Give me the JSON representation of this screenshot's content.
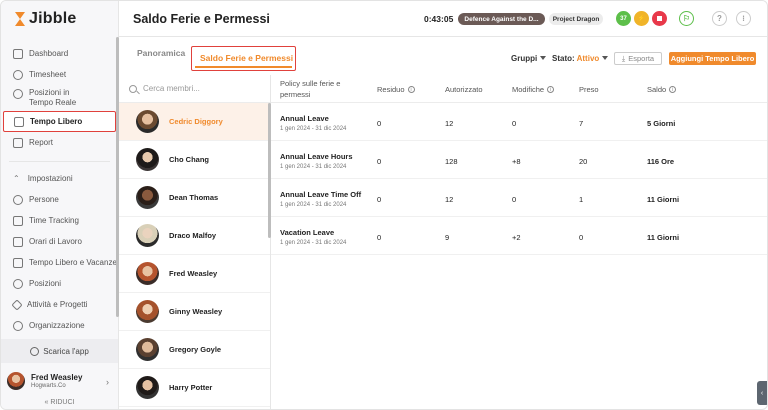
{
  "app": {
    "name": "Jibble"
  },
  "sidebar": {
    "items": [
      {
        "label": "Dashboard"
      },
      {
        "label": "Timesheet"
      },
      {
        "label": "Posizioni in Tempo Reale"
      },
      {
        "label": "Tempo Libero"
      },
      {
        "label": "Report"
      }
    ],
    "settings_items": [
      {
        "label": "Impostazioni"
      },
      {
        "label": "Persone"
      },
      {
        "label": "Time Tracking"
      },
      {
        "label": "Orari di Lavoro"
      },
      {
        "label": "Tempo Libero e Vacanze"
      },
      {
        "label": "Posizioni"
      },
      {
        "label": "Attività e Progetti"
      },
      {
        "label": "Organizzazione"
      }
    ],
    "download_label": "Scarica l'app",
    "user": {
      "name": "Fred Weasley",
      "org": "Hogwarts.Co"
    },
    "collapse_label": "RIDUCI"
  },
  "header": {
    "title": "Saldo Ferie e Permessi",
    "timer": "0:43:05",
    "activity": "Defence Against the D...",
    "project": "Project Dragon",
    "badge_count": "37",
    "accent_colors": {
      "primary": "#f08a2c",
      "green": "#5dbf4a",
      "yellow": "#f0b429",
      "red": "#e8394a",
      "highlight": "#e0413c"
    }
  },
  "tabs": {
    "overview": "Panoramica",
    "balance": "Saldo Ferie e Permessi"
  },
  "toolbar": {
    "groups_label": "Gruppi",
    "status_label": "Stato:",
    "status_value": "Attivo",
    "export_label": "Esporta",
    "add_label": "Aggiungi Tempo Libero"
  },
  "members": {
    "search_placeholder": "Cerca membri...",
    "list": [
      {
        "name": "Cedric Diggory",
        "selected": true
      },
      {
        "name": "Cho Chang"
      },
      {
        "name": "Dean Thomas"
      },
      {
        "name": "Draco Malfoy"
      },
      {
        "name": "Fred Weasley"
      },
      {
        "name": "Ginny Weasley"
      },
      {
        "name": "Gregory Goyle"
      },
      {
        "name": "Harry Potter"
      }
    ]
  },
  "table": {
    "headers": {
      "policy": "Policy sulle ferie e permessi",
      "residual": "Residuo",
      "authorized": "Autorizzato",
      "changes": "Modifiche",
      "taken": "Preso",
      "balance": "Saldo"
    },
    "rows": [
      {
        "policy": "Annual Leave",
        "range": "1 gen 2024 - 31 dic 2024",
        "residual": "0",
        "authorized": "12",
        "changes": "0",
        "taken": "7",
        "balance": "5 Giorni"
      },
      {
        "policy": "Annual Leave Hours",
        "range": "1 gen 2024 - 31 dic 2024",
        "residual": "0",
        "authorized": "128",
        "changes": "+8",
        "taken": "20",
        "balance": "116 Ore"
      },
      {
        "policy": "Annual Leave Time Off",
        "range": "1 gen 2024 - 31 dic 2024",
        "residual": "0",
        "authorized": "12",
        "changes": "0",
        "taken": "1",
        "balance": "11 Giorni"
      },
      {
        "policy": "Vacation Leave",
        "range": "1 gen 2024 - 31 dic 2024",
        "residual": "0",
        "authorized": "9",
        "changes": "+2",
        "taken": "0",
        "balance": "11 Giorni"
      }
    ]
  }
}
